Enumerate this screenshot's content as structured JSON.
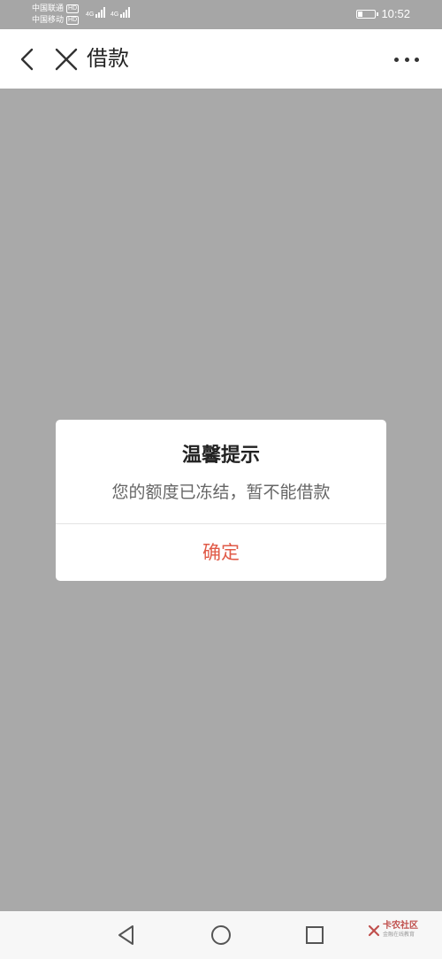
{
  "status_bar": {
    "carrier1": "中国联通",
    "carrier2": "中国移动",
    "hd": "HD",
    "network": "4G",
    "time": "10:52",
    "battery_level": 0.3
  },
  "header": {
    "title": "借款"
  },
  "dialog": {
    "title": "温馨提示",
    "message": "您的额度已冻结，暂不能借款",
    "confirm_label": "确定"
  },
  "watermark": {
    "main": "卡农社区",
    "sub": "金融在线教育"
  },
  "colors": {
    "overlay": "#a9a9a9",
    "accent": "#e05a47",
    "title_text": "#222222",
    "message_text": "#666666"
  },
  "icons": {
    "back": "chevron-left-icon",
    "close": "close-icon",
    "more": "more-horizontal-icon",
    "nav_back": "triangle-back-icon",
    "nav_home": "circle-home-icon",
    "nav_recent": "square-recent-icon"
  }
}
